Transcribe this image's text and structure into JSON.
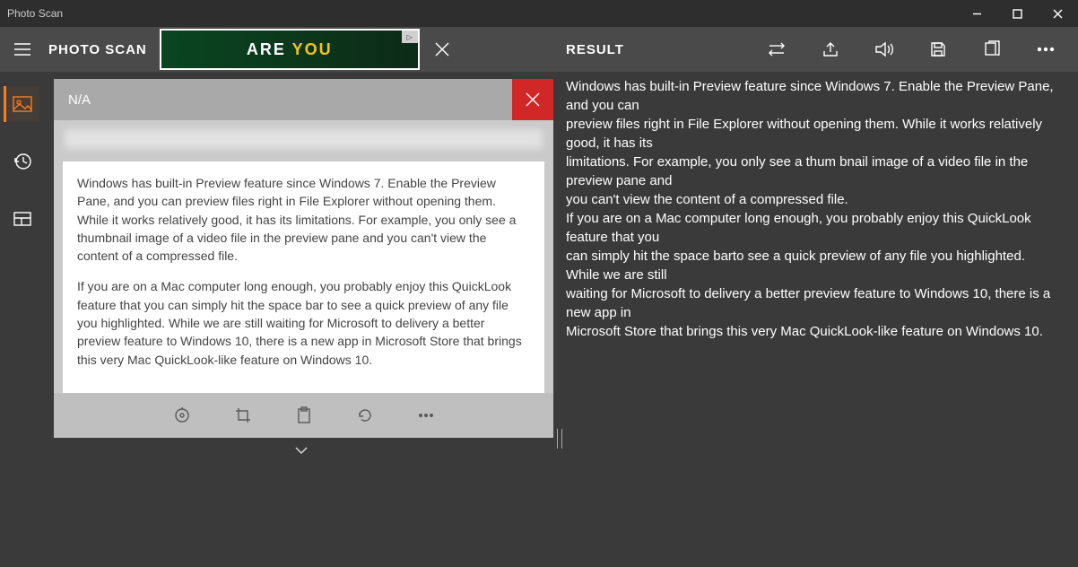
{
  "window": {
    "title": "Photo Scan"
  },
  "header": {
    "app_name": "PHOTO SCAN",
    "result_label": "RESULT"
  },
  "ad": {
    "text_white": "ARE ",
    "text_yellow": "YOU",
    "corner": "▷"
  },
  "preview": {
    "title": "N/A",
    "body_p1": "Windows has built-in Preview feature since Windows 7. Enable the Preview Pane, and you can preview files right in File Explorer without opening them. While it works relatively good, it has its limitations. For example, you only see a thumbnail image of a video file in the preview pane and you can't view the content of a compressed file.",
    "body_p2": "If you are on a Mac computer long enough, you probably enjoy this QuickLook feature that you can simply hit the space bar to see a quick preview of any file you highlighted. While we are still waiting for Microsoft to delivery a better preview feature to Windows 10, there is a new app in Microsoft Store that brings this very Mac QuickLook-like feature on Windows 10."
  },
  "result_text": "Windows has built-in Preview feature since Windows 7. Enable the Preview Pane, and you can\n preview files right in File Explorer without opening them. While it works relatively good, it has its\n limitations. For example, you only see a thum bnail image of a video file in the preview pane and\n you can't view the content of a compressed file.\n If you are on a Mac computer long enough, you probably enjoy this QuickLook feature that you\n can simply hit the space barto see a quick preview of any file you highlighted. While we are still\n waiting for Microsoft to delivery a better preview feature to Windows 10, there is a new app in\n Microsoft Store that brings this very Mac QuickLook-like feature on Windows 10.",
  "icons": {
    "swap": "swap-icon",
    "share": "share-icon",
    "speaker": "speaker-icon",
    "save": "save-icon",
    "copy": "copy-icon",
    "more": "more-icon",
    "image": "image-icon",
    "history": "history-icon",
    "layout": "layout-icon",
    "scan": "scan-icon",
    "crop": "crop-icon",
    "paste": "paste-icon",
    "rotate": "rotate-icon"
  }
}
